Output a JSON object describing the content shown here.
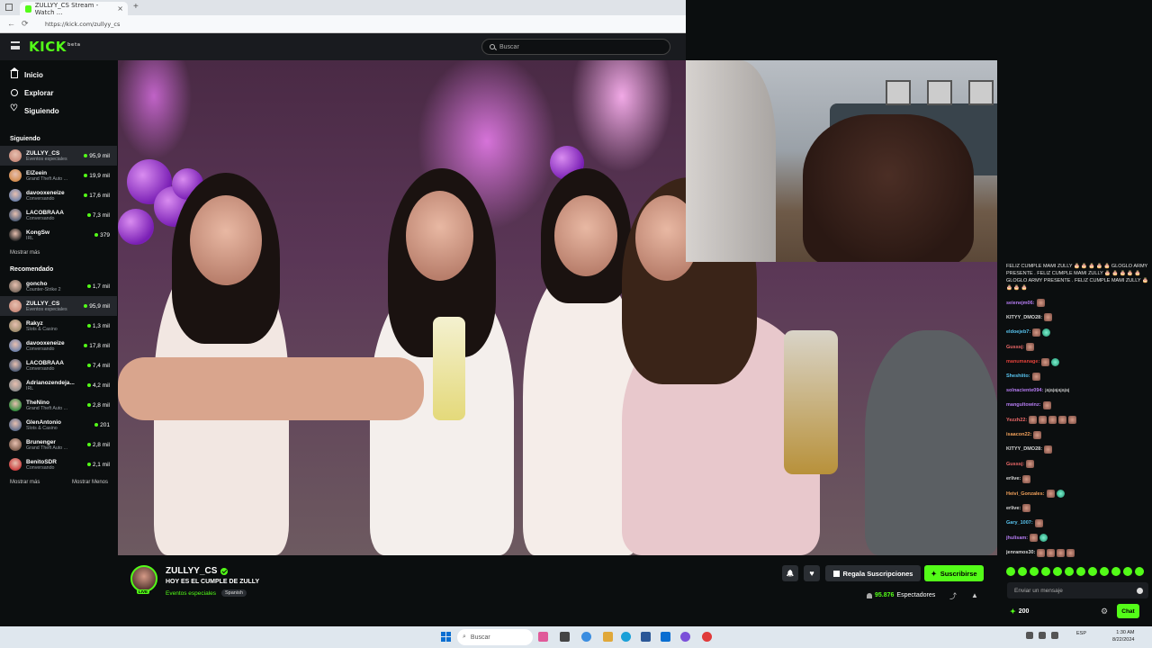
{
  "browser": {
    "tab_title": "ZULLYY_CS Stream - Watch ...",
    "tab_close": "×",
    "new_tab": "+",
    "url": "https://kick.com/zullyy_cs",
    "back": "←",
    "reload": "⟳"
  },
  "header": {
    "logo": "KICK",
    "logo_badge": "beta",
    "search_placeholder": "Buscar"
  },
  "nav": {
    "items": [
      {
        "label": "Inicio",
        "icon": "home-icon"
      },
      {
        "label": "Explorar",
        "icon": "compass-icon"
      },
      {
        "label": "Siguiendo",
        "icon": "heart-icon"
      }
    ]
  },
  "following": {
    "title": "Siguiendo",
    "channels": [
      {
        "name": "ZULLYY_CS",
        "category": "Eventos especiales",
        "viewers": "95,9 mil",
        "color": "#c88a7a"
      },
      {
        "name": "ElZeein",
        "category": "Grand Theft Auto ...",
        "viewers": "19,9 mil",
        "color": "#d18a4b"
      },
      {
        "name": "davooxeneize",
        "category": "Conversando",
        "viewers": "17,6 mil",
        "color": "#6b7fa8"
      },
      {
        "name": "LACOBRAAA",
        "category": "Conversando",
        "viewers": "7,3 mil",
        "color": "#4d5b75"
      },
      {
        "name": "KongSw",
        "category": "IRL",
        "viewers": "379",
        "color": "#222222"
      }
    ],
    "more": "Mostrar más"
  },
  "recommended": {
    "title": "Recomendado",
    "channels": [
      {
        "name": "goncho",
        "category": "Counter-Strike 2",
        "viewers": "1,7 mil",
        "color": "#7a6a5e"
      },
      {
        "name": "ZULLYY_CS",
        "category": "Eventos especiales",
        "viewers": "95,9 mil",
        "color": "#c88a7a"
      },
      {
        "name": "Rakyz",
        "category": "Slots & Casino",
        "viewers": "1,3 mil",
        "color": "#9a8a6a"
      },
      {
        "name": "davooxeneize",
        "category": "Conversando",
        "viewers": "17,8 mil",
        "color": "#6b7fa8"
      },
      {
        "name": "LACOBRAAA",
        "category": "Conversando",
        "viewers": "7,4 mil",
        "color": "#4d5b75"
      },
      {
        "name": "Adrianozendeja...",
        "category": "IRL",
        "viewers": "4,2 mil",
        "color": "#8a8a8a"
      },
      {
        "name": "TheNino",
        "category": "Grand Theft Auto ...",
        "viewers": "2,8 mil",
        "color": "#2d8a3a"
      },
      {
        "name": "GlenAntonio",
        "category": "Slots & Casino",
        "viewers": "201",
        "color": "#5a6a8a"
      },
      {
        "name": "Brunenger",
        "category": "Grand Theft Auto ...",
        "viewers": "2,8 mil",
        "color": "#7a5a4a"
      },
      {
        "name": "BenitoSDR",
        "category": "Conversando",
        "viewers": "2,1 mil",
        "color": "#c83a3a"
      }
    ],
    "more": "Mostrar más",
    "less": "Mostrar Menos"
  },
  "stream": {
    "streamer": "ZULLYY_CS",
    "live_badge": "LIVE",
    "title": "HOY ES EL CUMPLE DE ZULLY",
    "category": "Eventos especiales",
    "language": "Spanish",
    "gift_label": "Regala Suscripciones",
    "subscribe_label": "Suscribirse",
    "viewers_count": "95.876",
    "viewers_label": "Espectadores"
  },
  "chat": {
    "messages": [
      {
        "user": "",
        "text": "FELIZ CUMPLE MAMI ZULLY 🎂 🎂 🎂 🎂 🎂 GLOGLO ARMY PRESENTE . FELIZ CUMPLE MAMI ZULLY 🎂 🎂 🎂 🎂 🎂 GLOGLO ARMY PRESENTE . FELIZ CUMPLE MAMI ZULLY 🎂 🎂 🎂 🎂",
        "color": "#ffffff",
        "wrap": true,
        "emotes": 0
      },
      {
        "user": "seienejm06:",
        "text": "",
        "color": "#b57cf2",
        "emotes": 1
      },
      {
        "user": "KITYY_DMO28:",
        "text": "",
        "color": "#d9d9d9",
        "emotes": 1
      },
      {
        "user": "eldoejeb7:",
        "text": "",
        "color": "#58c4f0",
        "emotes": 1,
        "green": true
      },
      {
        "user": "Gusssj:",
        "text": "",
        "color": "#f06a6a",
        "emotes": 1
      },
      {
        "user": "manumanage:",
        "text": "",
        "color": "#e0413a",
        "emotes": 1,
        "green": true
      },
      {
        "user": "Sheshiito:",
        "text": "",
        "color": "#58c4f0",
        "emotes": 1
      },
      {
        "user": "solnaciente094:",
        "text": "jajajajajajaj",
        "color": "#b57cf2",
        "emotes": 0
      },
      {
        "user": "mangultowinz:",
        "text": "",
        "color": "#b57cf2",
        "emotes": 1
      },
      {
        "user": "Yezzh22:",
        "text": "",
        "color": "#f06a6a",
        "emotes": 5
      },
      {
        "user": "isaacon22:",
        "text": "",
        "color": "#f0a05a",
        "emotes": 1
      },
      {
        "user": "KITYY_DMO28:",
        "text": "",
        "color": "#d9d9d9",
        "emotes": 1
      },
      {
        "user": "Gusssj:",
        "text": "",
        "color": "#f06a6a",
        "emotes": 1
      },
      {
        "user": "erlive:",
        "text": "",
        "color": "#d9d9d9",
        "emotes": 1
      },
      {
        "user": "Heivi_Gonzales:",
        "text": "",
        "color": "#f0a05a",
        "emotes": 1,
        "green": true
      },
      {
        "user": "erlive:",
        "text": "",
        "color": "#d9d9d9",
        "emotes": 1
      },
      {
        "user": "Gary_1007:",
        "text": "",
        "color": "#58c4f0",
        "emotes": 1
      },
      {
        "user": "jhulisam:",
        "text": "",
        "color": "#b57cf2",
        "emotes": 1,
        "green": true
      },
      {
        "user": "jenramos30:",
        "text": "",
        "color": "#d9d9d9",
        "emotes": 4
      }
    ],
    "input_placeholder": "Enviar un mensaje",
    "points": "200",
    "send_label": "Chat"
  },
  "taskbar": {
    "search_label": "Buscar",
    "time": "1:30 AM",
    "date": "8/22/2024",
    "lang": "ESP"
  },
  "colors": {
    "accent": "#53fc18",
    "bg": "#0b0e0f"
  }
}
